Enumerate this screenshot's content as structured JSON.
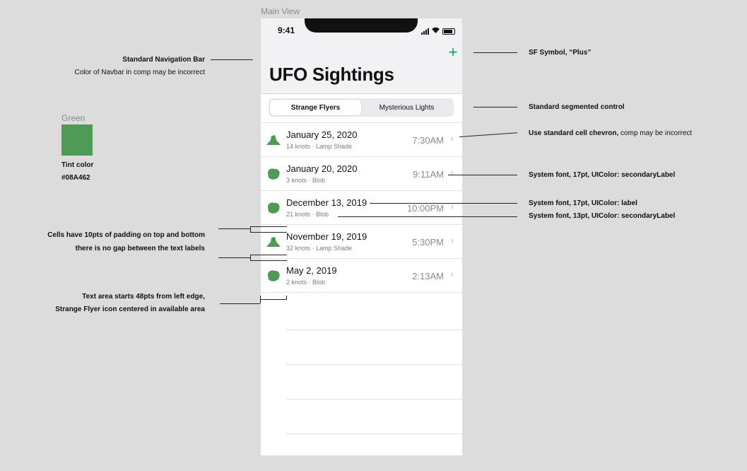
{
  "canvas": {
    "title": "Main View"
  },
  "status_bar": {
    "time": "9:41"
  },
  "nav": {
    "title": "UFO Sightings",
    "plus_symbol": "+"
  },
  "segmented": {
    "items": [
      "Strange Flyers",
      "Mysterious Lights"
    ],
    "selected": 0
  },
  "rows": [
    {
      "date": "January 25, 2020",
      "detail": "14 knots · Lamp Shade",
      "time": "7:30AM",
      "icon": "lamp-shade-icon"
    },
    {
      "date": "January 20, 2020",
      "detail": "3 knots · Blob",
      "time": "9:11AM",
      "icon": "blob-icon"
    },
    {
      "date": "December 13, 2019",
      "detail": "21 knots · Blob",
      "time": "10:00PM",
      "icon": "blob-icon"
    },
    {
      "date": "November 19, 2019",
      "detail": "32 knots · Lamp Shade",
      "time": "5:30PM",
      "icon": "lamp-shade-icon"
    },
    {
      "date": "May 2, 2019",
      "detail": "2 knots · Blob",
      "time": "2:13AM",
      "icon": "blob-icon"
    }
  ],
  "chevron": "›",
  "tint": {
    "label": "Green",
    "caption": "Tint color",
    "hex": "#08A462",
    "swatch_color": "#4f9a57"
  },
  "annotations": {
    "navbar_title": "Standard Navigation Bar",
    "navbar_sub": "Color of Navbar in comp may be incorrect",
    "plus": "SF Symbol, “Plus”",
    "segmented": "Standard segmented control",
    "chevron_bold": "Use standard cell chevron,",
    "chevron_rest": " comp may be incorrect",
    "time_font": "System font, 17pt, UIColor: secondaryLabel",
    "date_font": "System font, 17pt, UIColor: label",
    "sub_font": "System font, 13pt, UIColor: secondaryLabel",
    "padding_1": "Cells have 10pts of padding on top and bottom",
    "padding_2": "there is no gap between the text labels",
    "textarea_1": "Text area starts 48pts from left edge,",
    "textarea_2": "Strange Flyer icon centered in available area"
  }
}
